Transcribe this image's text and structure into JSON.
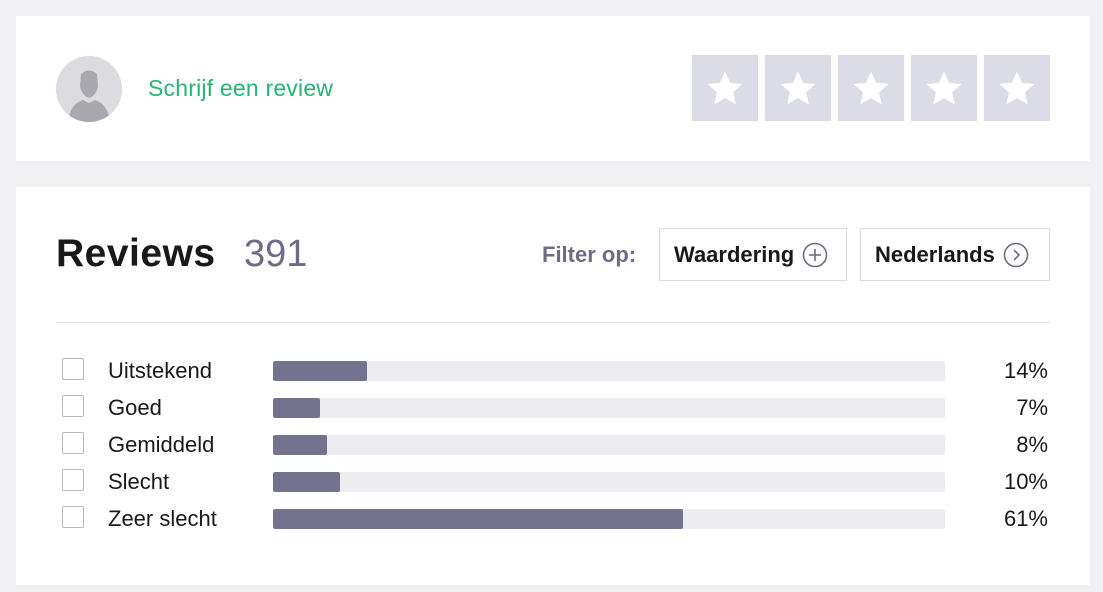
{
  "write_review": {
    "link_label": "Schrijf een review",
    "avatar_icon": "user-silhouette-icon",
    "stars": [
      {
        "icon": "star-icon",
        "rating": 1
      },
      {
        "icon": "star-icon",
        "rating": 2
      },
      {
        "icon": "star-icon",
        "rating": 3
      },
      {
        "icon": "star-icon",
        "rating": 4
      },
      {
        "icon": "star-icon",
        "rating": 5
      }
    ]
  },
  "reviews": {
    "title": "Reviews",
    "count": "391",
    "filter_label": "Filter op:",
    "filters": [
      {
        "label": "Waardering",
        "icon": "plus-circle-icon"
      },
      {
        "label": "Nederlands",
        "icon": "chevron-right-circle-icon"
      }
    ],
    "distribution": [
      {
        "label": "Uitstekend",
        "percent_text": "14%",
        "fraction": 0.14
      },
      {
        "label": "Goed",
        "percent_text": "7%",
        "fraction": 0.07
      },
      {
        "label": "Gemiddeld",
        "percent_text": "8%",
        "fraction": 0.08
      },
      {
        "label": "Slecht",
        "percent_text": "10%",
        "fraction": 0.1
      },
      {
        "label": "Zeer slecht",
        "percent_text": "61%",
        "fraction": 0.61
      }
    ]
  },
  "colors": {
    "link_green": "#22b573",
    "star_box_empty": "#dcdce6",
    "bar_fill": "#73738f",
    "bar_track": "#ececf1",
    "count_gray": "#6c6c85"
  }
}
